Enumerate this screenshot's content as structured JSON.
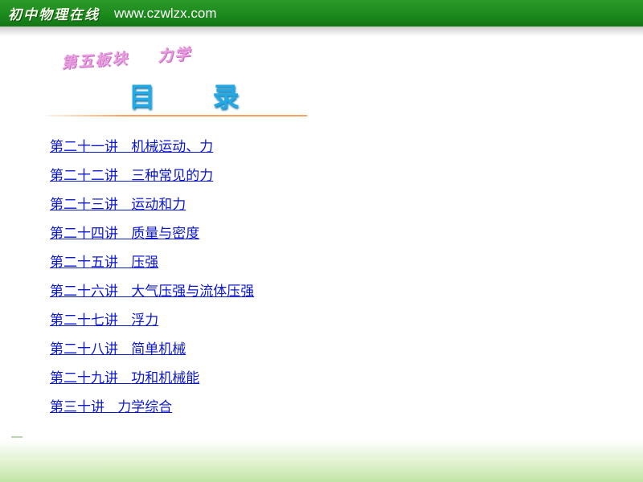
{
  "header": {
    "logo_text": "初中物理在线",
    "url": "www.czwlzx.com"
  },
  "section": {
    "part": "第五板块",
    "subject": "力学"
  },
  "toc": {
    "title": "目 录",
    "items": [
      {
        "lecture": "第二十一讲",
        "topic": "机械运动、力"
      },
      {
        "lecture": "第二十二讲",
        "topic": "三种常见的力"
      },
      {
        "lecture": "第二十三讲",
        "topic": "运动和力"
      },
      {
        "lecture": "第二十四讲",
        "topic": "质量与密度"
      },
      {
        "lecture": "第二十五讲",
        "topic": "压强"
      },
      {
        "lecture": "第二十六讲",
        "topic": "大气压强与流体压强"
      },
      {
        "lecture": "第二十七讲",
        "topic": "浮力"
      },
      {
        "lecture": "第二十八讲",
        "topic": "简单机械"
      },
      {
        "lecture": "第二十九讲",
        "topic": "功和机械能"
      },
      {
        "lecture": "第三十讲",
        "topic": "力学综合"
      }
    ]
  },
  "colors": {
    "header_green": "#1c8a1d",
    "link_blue": "#0b17c8",
    "title_blue": "#22a9e6",
    "section_pink": "#ea9ee2",
    "divider_orange": "#f4a460",
    "footer_green": "#d5edbf"
  }
}
